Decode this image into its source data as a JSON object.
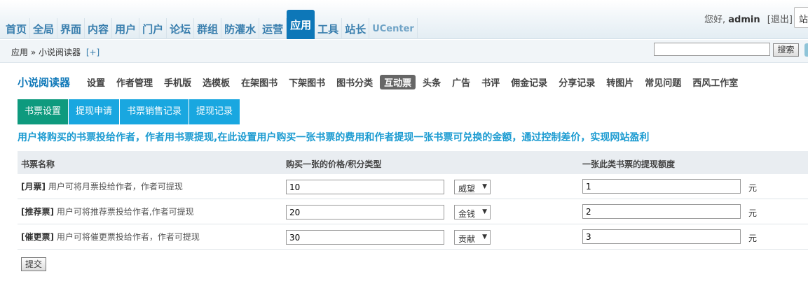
{
  "nav": {
    "items": [
      "首页",
      "全局",
      "界面",
      "内容",
      "用户",
      "门户",
      "论坛",
      "群组",
      "防灌水",
      "运营",
      "应用",
      "工具",
      "站长",
      "UCenter"
    ],
    "active_index": 10
  },
  "userbar": {
    "greeting": "您好,",
    "username": "admin",
    "logout": "[退出]",
    "site_btn": "站"
  },
  "breadcrumb": {
    "path": "应用 » 小说阅读器",
    "add": "[+]"
  },
  "search": {
    "value": "",
    "button": "搜索"
  },
  "plugin": {
    "title": "小说阅读器",
    "menu": [
      "设置",
      "作者管理",
      "手机版",
      "选模板",
      "在架图书",
      "下架图书",
      "图书分类",
      "互动票",
      "头条",
      "广告",
      "书评",
      "佣金记录",
      "分享记录",
      "转图片",
      "常见问题",
      "西风工作室"
    ],
    "active_menu_index": 7
  },
  "subtabs": {
    "items": [
      "书票设置",
      "提现申请",
      "书票销售记录",
      "提现记录"
    ],
    "active_index": 0
  },
  "notice": "用户将购买的书票投给作者，作者用书票提现,在此设置用户购买一张书票的费用和作者提现一张书票可兑换的金额，通过控制差价，实现网站盈利",
  "table": {
    "headers": [
      "书票名称",
      "购买一张的价格/积分类型",
      "一张此类书票的提现额度"
    ],
    "rows": [
      {
        "name": "[月票]",
        "desc": "用户可将月票投给作者，作者可提现",
        "price": "10",
        "credit": "威望",
        "amount": "1",
        "unit": "元"
      },
      {
        "name": "[推荐票]",
        "desc": "用户可将推荐票投给作者,作者可提现",
        "price": "20",
        "credit": "金钱",
        "amount": "2",
        "unit": "元"
      },
      {
        "name": "[催更票]",
        "desc": "用户可将催更票投给作者，作者可提现",
        "price": "30",
        "credit": "贡献",
        "amount": "3",
        "unit": "元"
      }
    ]
  },
  "submit_label": "提交"
}
